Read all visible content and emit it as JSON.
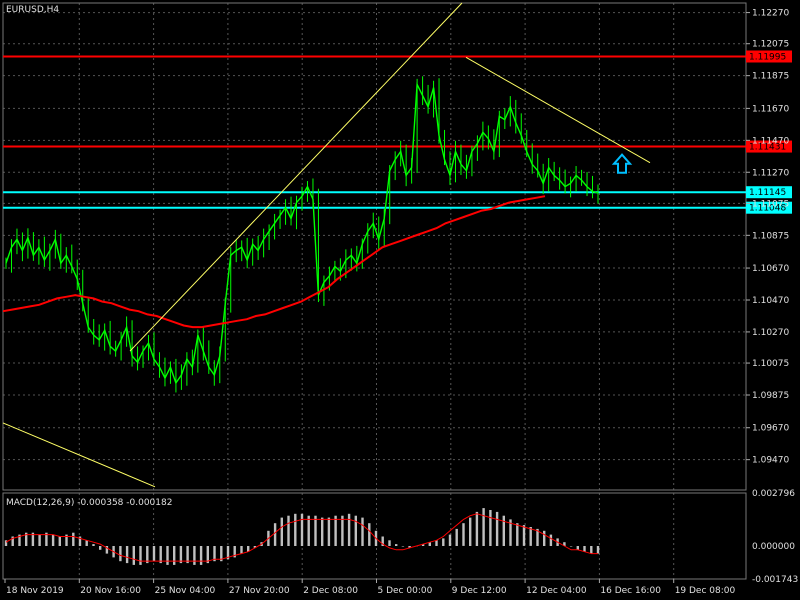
{
  "window": {
    "symbol_title": "EURUSD,H4"
  },
  "chart_data": {
    "type": "candlestick",
    "symbol": "EURUSD",
    "timeframe": "H4",
    "price_axis": {
      "ylim": [
        1.0928,
        1.1233
      ],
      "ticks": [
        "1.12270",
        "1.12075",
        "1.11875",
        "1.11670",
        "1.11470",
        "1.11270",
        "1.11075",
        "1.10875",
        "1.10670",
        "1.10470",
        "1.10270",
        "1.10075",
        "1.09875",
        "1.09670",
        "1.09470"
      ]
    },
    "time_axis": {
      "labels": [
        "18 Nov 2019",
        "20 Nov 16:00",
        "25 Nov 04:00",
        "27 Nov 20:00",
        "2 Dec 08:00",
        "5 Dec 00:00",
        "9 Dec 12:00",
        "12 Dec 04:00",
        "16 Dec 16:00",
        "19 Dec 08:00"
      ]
    },
    "price_series": {
      "name": "EURUSD H4 close",
      "color": "#00ff00",
      "values": [
        1.107,
        1.108,
        1.1085,
        1.1078,
        1.1086,
        1.1075,
        1.108,
        1.1072,
        1.1078,
        1.1085,
        1.107,
        1.1075,
        1.1068,
        1.106,
        1.1045,
        1.103,
        1.1025,
        1.1022,
        1.1028,
        1.1018,
        1.1015,
        1.1022,
        1.103,
        1.1012,
        1.1008,
        1.1015,
        1.102,
        1.101,
        1.1005,
        1.0998,
        1.1005,
        1.0995,
        1.1,
        1.101,
        1.1005,
        1.1025,
        1.1015,
        1.1005,
        1.1,
        1.1012,
        1.1045,
        1.1075,
        1.1078,
        1.108,
        1.1072,
        1.1082,
        1.1078,
        1.1085,
        1.109,
        1.1095,
        1.11,
        1.1105,
        1.1098,
        1.1108,
        1.1112,
        1.1118,
        1.111,
        1.105,
        1.1058,
        1.1062,
        1.1068,
        1.1065,
        1.1072,
        1.1075,
        1.107,
        1.1082,
        1.109,
        1.1095,
        1.1085,
        1.1098,
        1.1128,
        1.1135,
        1.114,
        1.1125,
        1.113,
        1.1182,
        1.1175,
        1.1168,
        1.118,
        1.115,
        1.1135,
        1.1125,
        1.114,
        1.1132,
        1.1128,
        1.114,
        1.1145,
        1.1152,
        1.1148,
        1.114,
        1.1162,
        1.116,
        1.1168,
        1.1158,
        1.115,
        1.114,
        1.1132,
        1.1128,
        1.112,
        1.113,
        1.1125,
        1.1122,
        1.1118,
        1.112,
        1.1125,
        1.1122,
        1.1118,
        1.1115,
        1.1114
      ]
    },
    "moving_average": {
      "color": "#ff0000",
      "values": [
        1.104,
        1.1041,
        1.1042,
        1.1043,
        1.1044,
        1.1046,
        1.1048,
        1.1049,
        1.105,
        1.1049,
        1.1048,
        1.1046,
        1.1045,
        1.1043,
        1.1041,
        1.104,
        1.1038,
        1.1037,
        1.1035,
        1.1033,
        1.1031,
        1.103,
        1.103,
        1.1031,
        1.1032,
        1.1033,
        1.1034,
        1.1035,
        1.1037,
        1.1038,
        1.104,
        1.1042,
        1.1044,
        1.1046,
        1.1049,
        1.1052,
        1.1055,
        1.106,
        1.1064,
        1.1068,
        1.1072,
        1.1076,
        1.108,
        1.1082,
        1.1084,
        1.1086,
        1.1088,
        1.109,
        1.1092,
        1.1095,
        1.1097,
        1.1099,
        1.1101,
        1.1103,
        1.1104,
        1.1106,
        1.1108,
        1.1109,
        1.111,
        1.1111,
        1.1112
      ]
    },
    "horizontal_levels": [
      {
        "price": "1.11995",
        "color": "#ff0000"
      },
      {
        "price": "1.11431",
        "color": "#ff0000"
      },
      {
        "price": "1.11145",
        "color": "#00ffff"
      },
      {
        "price": "1.11048",
        "color": "#00ffff"
      }
    ],
    "trendline_color": "#ffff66",
    "arrow_color": "#00bfff",
    "macd": {
      "label": "MACD(12,26,9) -0.000358 -0.000182",
      "ylim": [
        -0.001743,
        0.002796
      ],
      "ticks": [
        "0.002796",
        "0.000000",
        "-0.001743"
      ],
      "histogram_color": "#c0c0c0",
      "signal_color": "#ff0000",
      "histogram": [
        0.0003,
        0.0005,
        0.0006,
        0.0007,
        0.0007,
        0.0006,
        0.0007,
        0.0006,
        0.0005,
        0.0006,
        0.0007,
        0.0005,
        0.0003,
        0.0001,
        -0.0002,
        -0.0004,
        -0.0006,
        -0.0008,
        -0.0009,
        -0.001,
        -0.001,
        -0.0009,
        -0.0008,
        -0.0009,
        -0.001,
        -0.001,
        -0.0009,
        -0.0009,
        -0.001,
        -0.001,
        -0.0009,
        -0.0008,
        -0.0008,
        -0.0007,
        -0.0006,
        -0.0004,
        -0.0003,
        -0.0001,
        0.0002,
        0.0008,
        0.0012,
        0.0015,
        0.0016,
        0.0017,
        0.0017,
        0.0016,
        0.0016,
        0.0015,
        0.0015,
        0.0016,
        0.0016,
        0.0017,
        0.0016,
        0.0015,
        0.0012,
        0.0008,
        0.0005,
        0.0003,
        0.0001,
        0.0,
        -0.0001,
        0.0,
        0.0001,
        0.0002,
        0.0003,
        0.0004,
        0.0006,
        0.0009,
        0.0012,
        0.0015,
        0.0018,
        0.002,
        0.0019,
        0.0018,
        0.0016,
        0.0014,
        0.0012,
        0.0011,
        0.001,
        0.0009,
        0.0008,
        0.0006,
        0.0004,
        0.0002,
        0.0,
        -0.0002,
        -0.0003,
        -0.0004,
        -0.0004
      ],
      "signal": [
        0.0002,
        0.0004,
        0.0005,
        0.0006,
        0.0006,
        0.0006,
        0.0006,
        0.0006,
        0.0005,
        0.0005,
        0.0005,
        0.0004,
        0.0003,
        0.0002,
        0.0001,
        -0.0001,
        -0.0003,
        -0.0005,
        -0.0006,
        -0.0007,
        -0.0008,
        -0.0008,
        -0.0008,
        -0.0008,
        -0.0008,
        -0.0008,
        -0.0008,
        -0.0008,
        -0.0008,
        -0.0008,
        -0.0008,
        -0.0007,
        -0.0007,
        -0.0006,
        -0.0005,
        -0.0004,
        -0.0003,
        -0.0001,
        0.0001,
        0.0004,
        0.0007,
        0.001,
        0.0012,
        0.0013,
        0.0014,
        0.0014,
        0.0014,
        0.0014,
        0.0014,
        0.0014,
        0.0014,
        0.0014,
        0.0013,
        0.0011,
        0.0008,
        0.0004,
        0.0001,
        -0.0001,
        -0.0002,
        -0.0002,
        -0.0001,
        0.0,
        0.0001,
        0.0002,
        0.0003,
        0.0005,
        0.0008,
        0.0011,
        0.0014,
        0.0016,
        0.0017,
        0.0016,
        0.0015,
        0.0014,
        0.0013,
        0.0012,
        0.0011,
        0.001,
        0.0009,
        0.0008,
        0.0006,
        0.0004,
        0.0002,
        0.0,
        -0.0002,
        -0.0002,
        -0.0003,
        -0.0004,
        -0.0004
      ]
    }
  }
}
